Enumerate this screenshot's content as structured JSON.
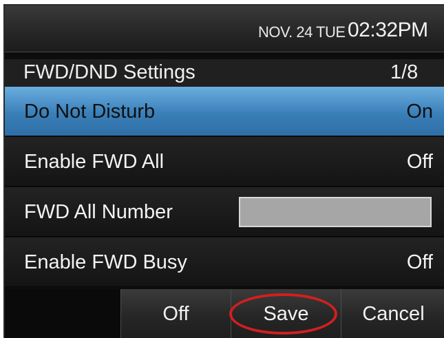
{
  "status_bar": {
    "date": "NOV. 24 TUE",
    "time": "02:32PM"
  },
  "header": {
    "title": "FWD/DND Settings",
    "page_indicator": "1/8"
  },
  "settings": [
    {
      "label": "Do Not Disturb",
      "value": "On",
      "selected": true
    },
    {
      "label": "Enable FWD All",
      "value": "Off",
      "selected": false
    },
    {
      "label": "FWD All Number",
      "value": "",
      "selected": false
    },
    {
      "label": "Enable FWD Busy",
      "value": "Off",
      "selected": false
    }
  ],
  "softkeys": {
    "key2": "Off",
    "key3": "Save",
    "key4": "Cancel"
  },
  "colors": {
    "selection": "#3a7fb8",
    "highlight_ring": "#d21f1f"
  }
}
